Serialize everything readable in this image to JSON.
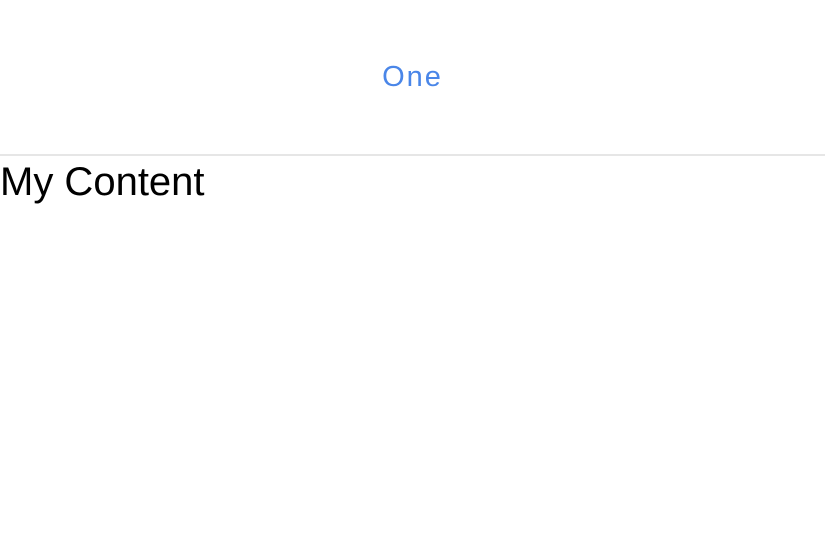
{
  "tabs": {
    "items": [
      {
        "label": "One",
        "active": true
      }
    ]
  },
  "content": {
    "text": "My Content"
  },
  "colors": {
    "tab_label": "#4a86e8",
    "divider": "#e6e6e6",
    "content_text": "#000000",
    "background": "#ffffff"
  }
}
